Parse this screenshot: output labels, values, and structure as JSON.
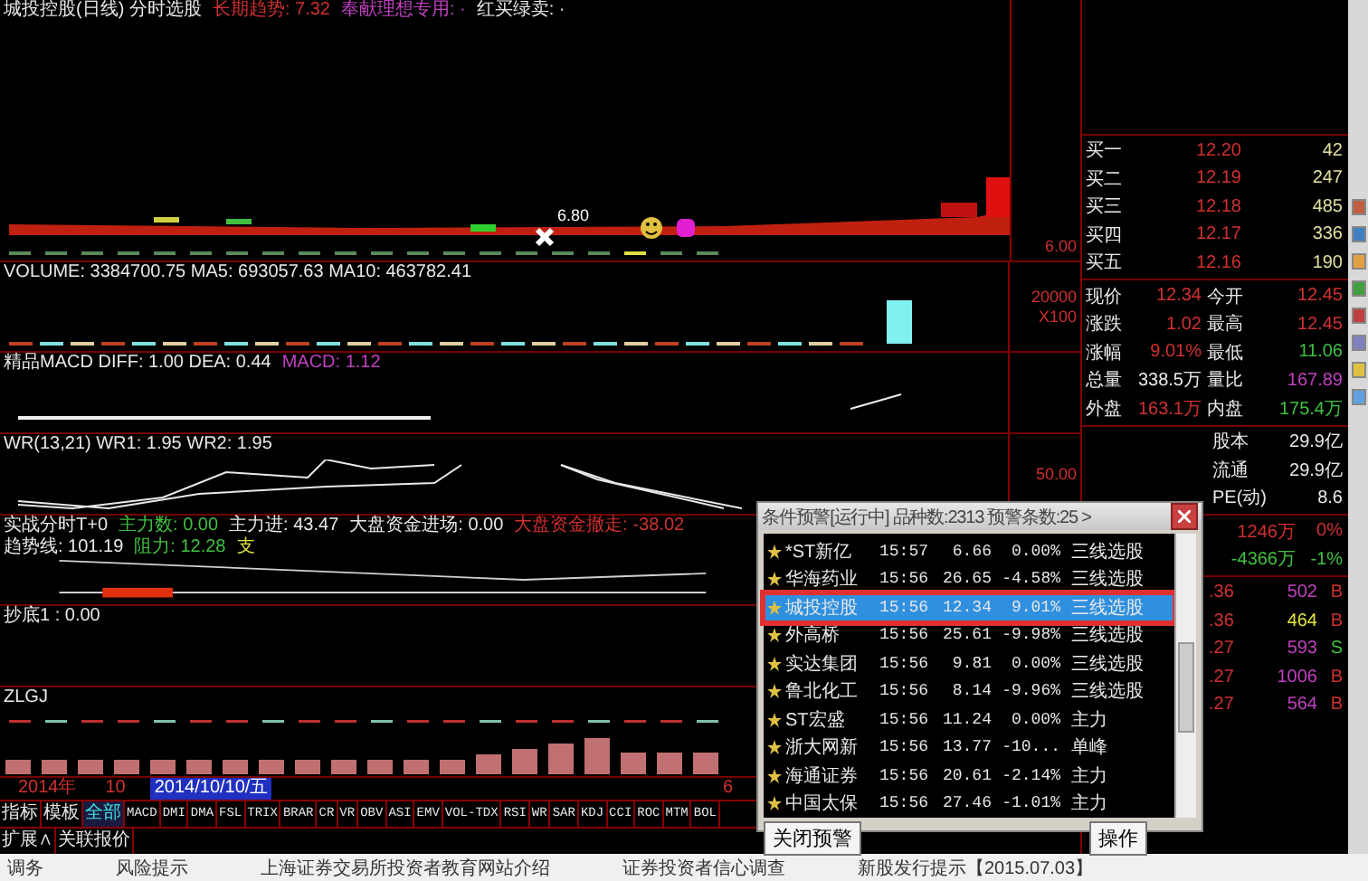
{
  "panes": [
    {
      "kind": "price",
      "legend": [
        {
          "text": "城投控股(日线) 分时选股",
          "color": "#e8e8e8"
        },
        {
          "text": "长期趋势: 7.32",
          "color": "#d03030"
        },
        {
          "text": "奉献理想专用: ·",
          "color": "#c040c0"
        },
        {
          "text": "红买绿卖: ·",
          "color": "#e8e8e8"
        }
      ],
      "marker_text": "6.80",
      "axis": [
        "6.00"
      ]
    },
    {
      "kind": "volume",
      "legend": [
        {
          "text": "VOLUME: 3384700.75 MA5: 693057.63 MA10: 463782.41",
          "color": "#e8e8e8"
        }
      ],
      "axis": [
        "20000",
        "X100"
      ]
    },
    {
      "kind": "macd",
      "legend": [
        {
          "text": "精品MACD DIFF: 1.00 DEA: 0.44",
          "color": "#e8e8e8"
        },
        {
          "text": "MACD: 1.12",
          "color": "#c040c0"
        }
      ]
    },
    {
      "kind": "wr",
      "legend": [
        {
          "text": "WR(13,21) WR1: 1.95 WR2: 1.95",
          "color": "#e8e8e8"
        }
      ],
      "axis": [
        "50.00"
      ]
    },
    {
      "kind": "t0",
      "legend": [
        {
          "text": "实战分时T+0",
          "color": "#e8e8e8"
        },
        {
          "text": "主力数: 0.00",
          "color": "#40c040"
        },
        {
          "text": "主力进: 43.47",
          "color": "#e8e8e8"
        },
        {
          "text": "大盘资金进场: 0.00",
          "color": "#e8e8e8"
        },
        {
          "text": "大盘资金撤走: -38.02",
          "color": "#d03030"
        },
        {
          "text": "趋势线: 101.19",
          "color": "#e8e8e8"
        },
        {
          "text": "阻力: 12.28",
          "color": "#40c040"
        },
        {
          "text": "支",
          "color": "#e0e040"
        }
      ]
    },
    {
      "kind": "blank",
      "legend": [
        {
          "text": "抄底1 : 0.00",
          "color": "#e8e8e8"
        }
      ]
    },
    {
      "kind": "zlgj",
      "legend": [
        {
          "text": "ZLGJ",
          "color": "#e8e8e8"
        }
      ]
    }
  ],
  "date_axis": [
    {
      "text": "2014年",
      "selected": false
    },
    {
      "text": "10",
      "selected": false
    },
    {
      "text": "2014/10/10/五",
      "selected": true
    },
    {
      "text": "6",
      "selected": false
    }
  ],
  "indicator_tabs": [
    {
      "label": "指标",
      "selected": false,
      "kind": "group"
    },
    {
      "label": "模板",
      "selected": false,
      "kind": "group"
    },
    {
      "label": "全部",
      "selected": true,
      "kind": "group"
    },
    {
      "label": "MACD",
      "selected": false
    },
    {
      "label": "DMI",
      "selected": false
    },
    {
      "label": "DMA",
      "selected": false
    },
    {
      "label": "FSL",
      "selected": false
    },
    {
      "label": "TRIX",
      "selected": false
    },
    {
      "label": "BRAR",
      "selected": false
    },
    {
      "label": "CR",
      "selected": false
    },
    {
      "label": "VR",
      "selected": false
    },
    {
      "label": "OBV",
      "selected": false
    },
    {
      "label": "ASI",
      "selected": false
    },
    {
      "label": "EMV",
      "selected": false
    },
    {
      "label": "VOL-TDX",
      "selected": false
    },
    {
      "label": "RSI",
      "selected": false
    },
    {
      "label": "WR",
      "selected": false
    },
    {
      "label": "SAR",
      "selected": false
    },
    {
      "label": "KDJ",
      "selected": false
    },
    {
      "label": "CCI",
      "selected": false
    },
    {
      "label": "ROC",
      "selected": false
    },
    {
      "label": "MTM",
      "selected": false
    },
    {
      "label": "BOL",
      "selected": false
    }
  ],
  "extra_tabs": [
    "扩展∧",
    "关联报价"
  ],
  "quote": {
    "bids": [
      {
        "label": "买一",
        "price": "12.20",
        "volume": "42"
      },
      {
        "label": "买二",
        "price": "12.19",
        "volume": "247"
      },
      {
        "label": "买三",
        "price": "12.18",
        "volume": "485"
      },
      {
        "label": "买四",
        "price": "12.17",
        "volume": "336"
      },
      {
        "label": "买五",
        "price": "12.16",
        "volume": "190"
      }
    ],
    "stats": [
      {
        "left": {
          "label": "现价",
          "value": "12.34",
          "color": "#d03030"
        },
        "right": {
          "label": "今开",
          "value": "12.45",
          "color": "#d03030"
        }
      },
      {
        "left": {
          "label": "涨跌",
          "value": "1.02",
          "color": "#d03030"
        },
        "right": {
          "label": "最高",
          "value": "12.45",
          "color": "#d03030"
        }
      },
      {
        "left": {
          "label": "涨幅",
          "value": "9.01%",
          "color": "#d03030"
        },
        "right": {
          "label": "最低",
          "value": "11.06",
          "color": "#40c040"
        }
      },
      {
        "left": {
          "label": "总量",
          "value": "338.5万",
          "color": "#e8e8e8"
        },
        "right": {
          "label": "量比",
          "value": "167.89",
          "color": "#c040c0"
        }
      },
      {
        "left": {
          "label": "外盘",
          "value": "163.1万",
          "color": "#d03030"
        },
        "right": {
          "label": "内盘",
          "value": "175.4万",
          "color": "#40c040"
        }
      }
    ],
    "info": [
      {
        "label": "股本",
        "value": "29.9亿"
      },
      {
        "label": "流通",
        "value": "29.9亿"
      },
      {
        "label": "PE(动)",
        "value": "8.6"
      }
    ],
    "flows": [
      {
        "amount": "1246万",
        "percent": "0%",
        "color": "#d03030"
      },
      {
        "amount": "-4366万",
        "percent": "-1%",
        "color": "#40c040"
      }
    ],
    "ticks": [
      {
        "price": ".36",
        "volume": "502",
        "side": "B"
      },
      {
        "price": ".36",
        "volume": "464",
        "side": "B"
      },
      {
        "price": ".27",
        "volume": "593",
        "side": "S"
      },
      {
        "price": ".27",
        "volume": "1006",
        "side": "B"
      },
      {
        "price": ".27",
        "volume": "564",
        "side": "B"
      }
    ]
  },
  "alert_dialog": {
    "title": "条件预警[运行中] 品种数:2313 预警条数:25 >",
    "rows": [
      {
        "name": "*ST新亿",
        "time": "15:57",
        "price": "6.66",
        "change": "0.00%",
        "type": "三线选股",
        "selected": false
      },
      {
        "name": "华海药业",
        "time": "15:56",
        "price": "26.65",
        "change": "-4.58%",
        "type": "三线选股",
        "selected": false
      },
      {
        "name": "城投控股",
        "time": "15:56",
        "price": "12.34",
        "change": "9.01%",
        "type": "三线选股",
        "selected": true
      },
      {
        "name": "外高桥",
        "time": "15:56",
        "price": "25.61",
        "change": "-9.98%",
        "type": "三线选股",
        "selected": false
      },
      {
        "name": "实达集团",
        "time": "15:56",
        "price": "9.81",
        "change": "0.00%",
        "type": "三线选股",
        "selected": false
      },
      {
        "name": "鲁北化工",
        "time": "15:56",
        "price": "8.14",
        "change": "-9.96%",
        "type": "三线选股",
        "selected": false
      },
      {
        "name": "ST宏盛",
        "time": "15:56",
        "price": "11.24",
        "change": "0.00%",
        "type": "主力",
        "selected": false
      },
      {
        "name": "浙大网新",
        "time": "15:56",
        "price": "13.77",
        "change": "-10...",
        "type": "单峰",
        "selected": false
      },
      {
        "name": "海通证券",
        "time": "15:56",
        "price": "20.61",
        "change": "-2.14%",
        "type": "主力",
        "selected": false
      },
      {
        "name": "中国太保",
        "time": "15:56",
        "price": "27.46",
        "change": "-1.01%",
        "type": "主力",
        "selected": false
      }
    ],
    "buttons": [
      "关闭预警",
      "操作"
    ]
  },
  "status_bar": [
    "调务",
    "风险提示",
    "上海证券交易所投资者教育网站介绍",
    "证券投资者信心调查",
    "新股发行提示【2015.07.03】"
  ]
}
